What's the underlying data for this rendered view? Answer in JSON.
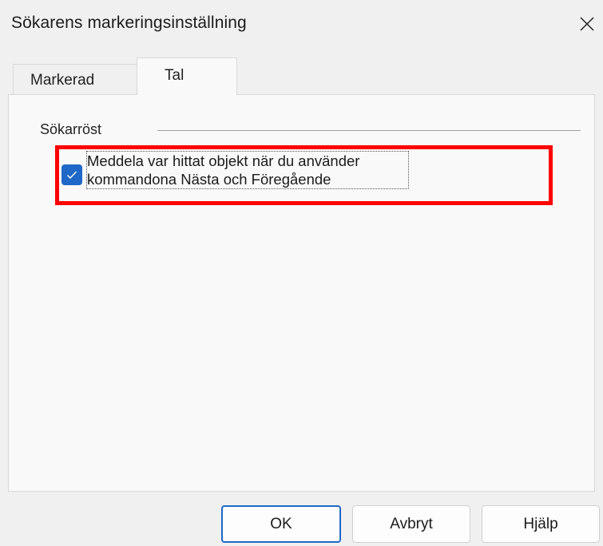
{
  "window": {
    "title": "Sökarens markeringsinställning",
    "close_icon": "close-icon"
  },
  "tabs": [
    {
      "label": "Markerad",
      "active": false
    },
    {
      "label": "Tal",
      "active": true
    }
  ],
  "panel": {
    "group_label": "Sökarröst",
    "checkbox": {
      "checked": true,
      "label_line1": "Meddela var hittat objekt när du använder",
      "label_line2": "kommandona Nästa och Föregående"
    }
  },
  "buttons": {
    "ok": "OK",
    "cancel": "Avbryt",
    "help": "Hjälp"
  },
  "colors": {
    "accent": "#1f68c7",
    "highlight": "#ff0000",
    "background": "#f0f0f0",
    "panel": "#f9f9f9"
  }
}
